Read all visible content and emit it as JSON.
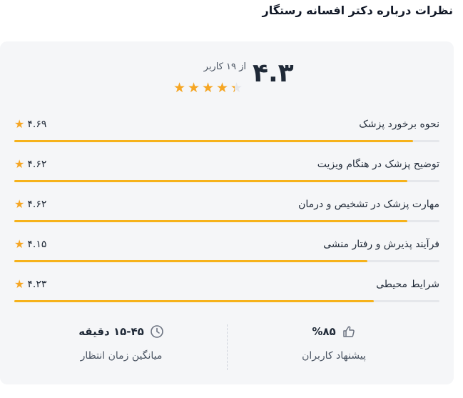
{
  "section_title": "نظرات درباره دکتر افسانه رستگار",
  "summary": {
    "score": "۴.۳",
    "count_text": "از ۱۹ کاربر",
    "star_level": 4.3,
    "star_color": "#f6a623"
  },
  "rating_items": [
    {
      "label": "نحوه برخورد پزشک",
      "value": "۴.۶۹",
      "score": 4.69
    },
    {
      "label": "توضیح پزشک در هنگام ویزیت",
      "value": "۴.۶۲",
      "score": 4.62
    },
    {
      "label": "مهارت پزشک در تشخیص و درمان",
      "value": "۴.۶۲",
      "score": 4.62
    },
    {
      "label": "فرآیند پذیرش و رفتار منشی",
      "value": "۴.۱۵",
      "score": 4.15
    },
    {
      "label": "شرایط محیطی",
      "value": "۴.۲۳",
      "score": 4.23
    }
  ],
  "stats": {
    "wait_value": "۱۵-۴۵ دقیقه",
    "wait_label": "میانگین زمان انتظار",
    "wait_icon": "clock-icon",
    "recommend_value": "%۸۵",
    "recommend_label": "پیشنهاد کاربران",
    "recommend_icon": "thumbs-up-icon"
  },
  "colors": {
    "accent": "#f6b21b",
    "card_bg": "#f5f6f8"
  }
}
